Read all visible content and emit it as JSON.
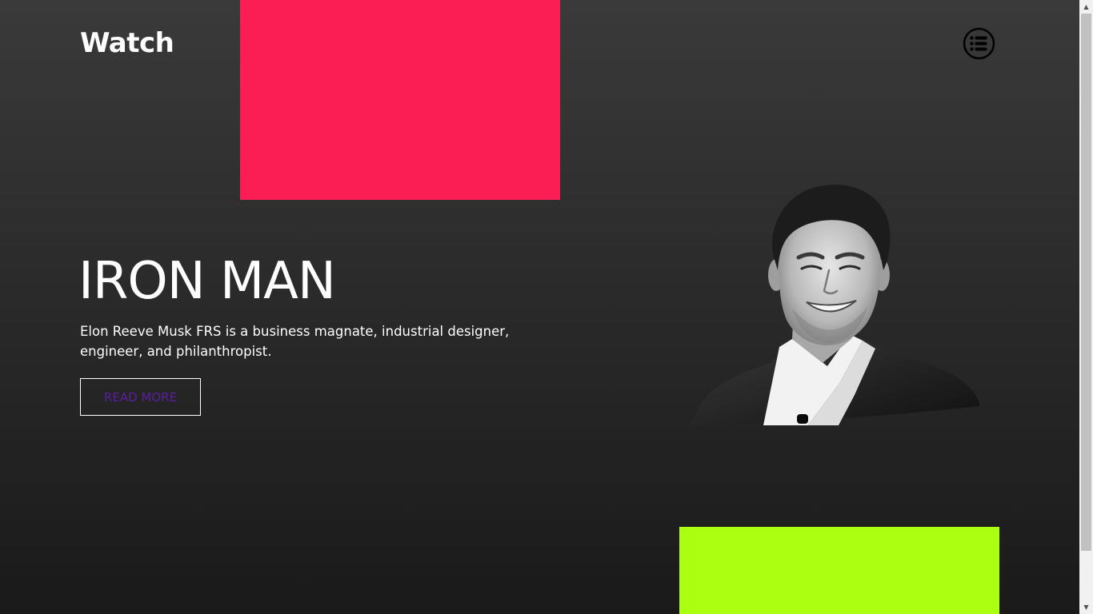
{
  "brand": {
    "logo_text": "Watch"
  },
  "header": {
    "menu_icon": "list-menu-icon"
  },
  "hero": {
    "title": "IRON MAN",
    "description": "Elon Reeve Musk FRS is a business magnate, industrial designer, engineer, and philanthropist.",
    "cta_label": "READ MORE",
    "portrait_icon": "portrait-photo"
  },
  "colors": {
    "accent_pink": "#fa1e54",
    "accent_green": "#adff11",
    "cta_text": "#5a1ea0",
    "background_top": "#3a3a3a",
    "background_bottom": "#1a1a1a"
  },
  "scrollbar": {
    "up_icon": "scroll-up-arrow-icon",
    "down_icon": "scroll-down-arrow-icon"
  }
}
